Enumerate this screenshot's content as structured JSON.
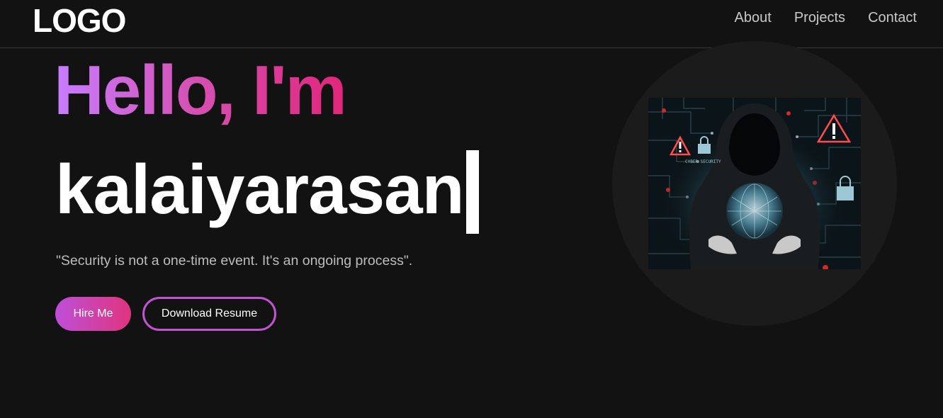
{
  "nav": {
    "logo": "LOGO",
    "links": [
      "About",
      "Projects",
      "Contact"
    ]
  },
  "hero": {
    "greeting": "Hello, I'm",
    "name": "kalaiyarasan",
    "quote": "\"Security is not a one-time event. It's an ongoing process\".",
    "buttons": {
      "hire": "Hire Me",
      "resume": "Download Resume"
    },
    "image": {
      "icon": "hooded-hacker-cyber-security-illustration",
      "label": "CYBER SECURITY"
    }
  },
  "colors": {
    "background": "#131213",
    "gradient_start": "#c77dff",
    "gradient_end": "#e0267a",
    "nav_text": "#c9c9c9",
    "quote_text": "#bdbdbd"
  }
}
